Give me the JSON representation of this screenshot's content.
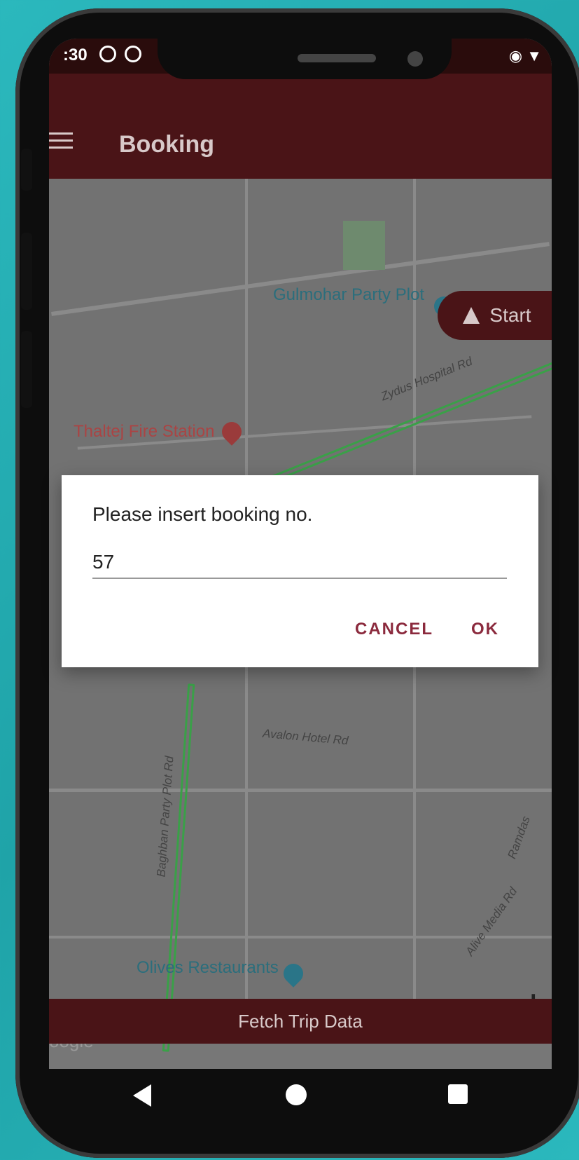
{
  "status_bar": {
    "time": ":30"
  },
  "app_bar": {
    "title": "Booking"
  },
  "map": {
    "start_label": "Start",
    "labels": {
      "gulmohar": "Gulmohar Party Plot",
      "thaltej": "Thaltej Fire Station",
      "zydus": "Zydus Hospital Rd",
      "avalon": "Avalon Hotel Rd",
      "baghban": "Baghban Party Plot Rd",
      "olives": "Olives Restaurants",
      "alive_media": "Alive Media Rd",
      "ramdas": "Ramdas",
      "google": "oogle"
    }
  },
  "dialog": {
    "title": "Please insert booking no.",
    "input_value": "57",
    "cancel_label": "CANCEL",
    "ok_label": "OK"
  },
  "footer": {
    "fetch_label": "Fetch Trip Data"
  },
  "colors": {
    "primary": "#4a1417",
    "accent": "#8b2a3d",
    "background": "#2bb8bd"
  }
}
